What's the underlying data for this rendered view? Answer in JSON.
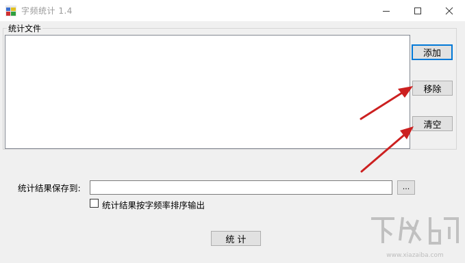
{
  "window": {
    "title": "字频统计 1.4"
  },
  "file_group": {
    "label": "统计文件"
  },
  "buttons": {
    "add": "添加",
    "remove": "移除",
    "clear": "清空",
    "browse": "...",
    "run": "统 计"
  },
  "save": {
    "label": "统计结果保存到:",
    "value": ""
  },
  "sort_option": {
    "label": "统计结果按字频率排序输出",
    "checked": false
  },
  "watermark": {
    "text": "下载吧",
    "subtext": "www.xiazaiba.com"
  },
  "colors": {
    "annotation_arrow": "#cc2020",
    "focus_border": "#0078d7"
  }
}
